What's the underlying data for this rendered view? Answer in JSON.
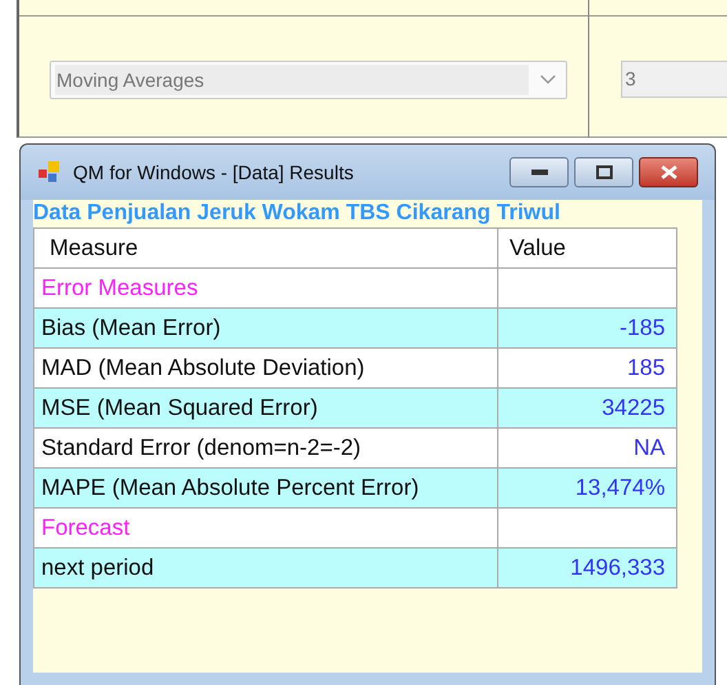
{
  "toolbar": {
    "method": {
      "value": "Moving Averages"
    },
    "periods": {
      "value": "3"
    }
  },
  "window": {
    "title": "QM for Windows - [Data] Results"
  },
  "heading": "Data Penjualan Jeruk Wokam TBS Cikarang Triwul",
  "table": {
    "columns": [
      "Measure",
      "Value"
    ],
    "rows": [
      {
        "kind": "section",
        "measure": "Error Measures",
        "shaded": false
      },
      {
        "kind": "data",
        "measure": "Bias (Mean Error)",
        "value": "-185",
        "shaded": true
      },
      {
        "kind": "data",
        "measure": "MAD (Mean Absolute Deviation)",
        "value": "185",
        "shaded": false
      },
      {
        "kind": "data",
        "measure": "MSE (Mean Squared Error)",
        "value": "34225",
        "shaded": true
      },
      {
        "kind": "data",
        "measure": "Standard Error (denom=n-2=-2)",
        "value": "NA",
        "shaded": false
      },
      {
        "kind": "data",
        "measure": "MAPE (Mean Absolute Percent Error)",
        "value": "13,474%",
        "shaded": true
      },
      {
        "kind": "section",
        "measure": "Forecast",
        "shaded": false
      },
      {
        "kind": "data",
        "measure": "next period",
        "value": "1496,333",
        "shaded": true
      }
    ]
  }
}
